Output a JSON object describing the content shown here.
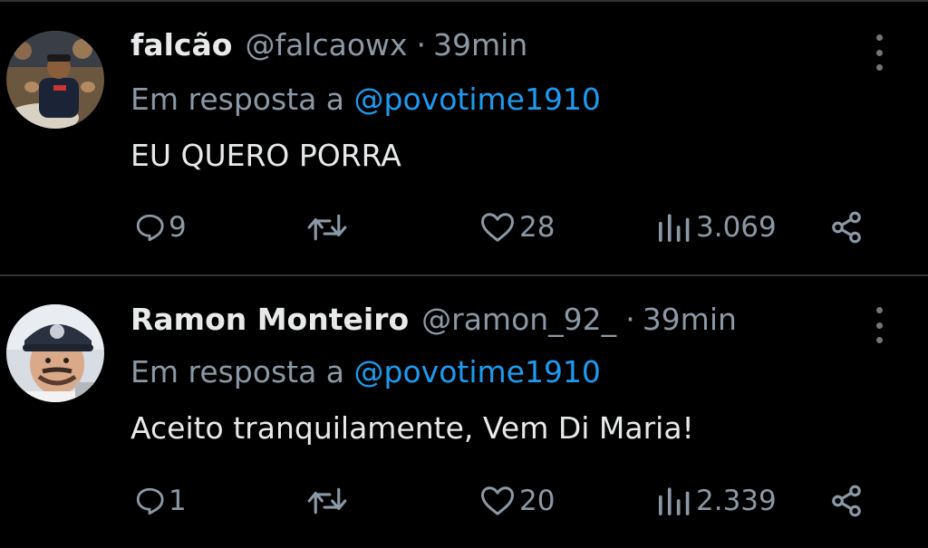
{
  "tweets": [
    {
      "display_name": "falcão",
      "handle": "@falcaowx",
      "separator": "·",
      "time": "39min",
      "reply_prefix": "Em resposta a",
      "reply_to": "@povotime1910",
      "text": "EU QUERO PORRA",
      "replies": "9",
      "likes": "28",
      "views": "3.069"
    },
    {
      "display_name": "Ramon Monteiro",
      "handle": "@ramon_92_",
      "separator": "·",
      "time": "39min",
      "reply_prefix": "Em resposta a",
      "reply_to": "@povotime1910",
      "text": "Aceito tranquilamente, Vem Di Maria!",
      "replies": "1",
      "likes": "20",
      "views": "2.339"
    }
  ],
  "icons": {
    "reply": "reply-icon",
    "retweet": "retweet-icon",
    "like": "heart-icon",
    "views": "views-icon",
    "share": "share-icon",
    "more": "more-icon"
  },
  "colors": {
    "background": "#000000",
    "text": "#e7e9ea",
    "secondary": "#8b98a5",
    "mention": "#1d9bf0",
    "divider": "#2f3336"
  }
}
